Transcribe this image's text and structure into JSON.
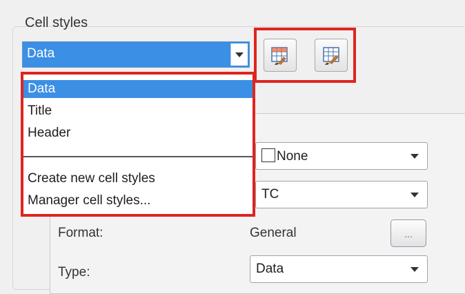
{
  "panel": {
    "section_label": "Cell styles"
  },
  "cell_style_combo": {
    "selected_value": "Data",
    "icon": "chevron-down-icon"
  },
  "toolbar_buttons": [
    {
      "name": "create-cell-style-button",
      "icon": "table-paintbrush-icon"
    },
    {
      "name": "manage-cell-styles-button",
      "icon": "table-paintbrush-icon"
    }
  ],
  "dropdown": {
    "items": [
      "Data",
      "Title",
      "Header"
    ],
    "actions": [
      "Create new cell styles",
      "Manager cell styles..."
    ],
    "selected_index": 0
  },
  "properties": {
    "fill_color_value": "None",
    "second_select_value": "TC",
    "format_label": "Format:",
    "format_value": "General",
    "format_button_label": "...",
    "type_label": "Type:",
    "type_value": "Data"
  },
  "colors": {
    "highlight": "#3b8fe4",
    "annotation_red": "#e0241e"
  }
}
